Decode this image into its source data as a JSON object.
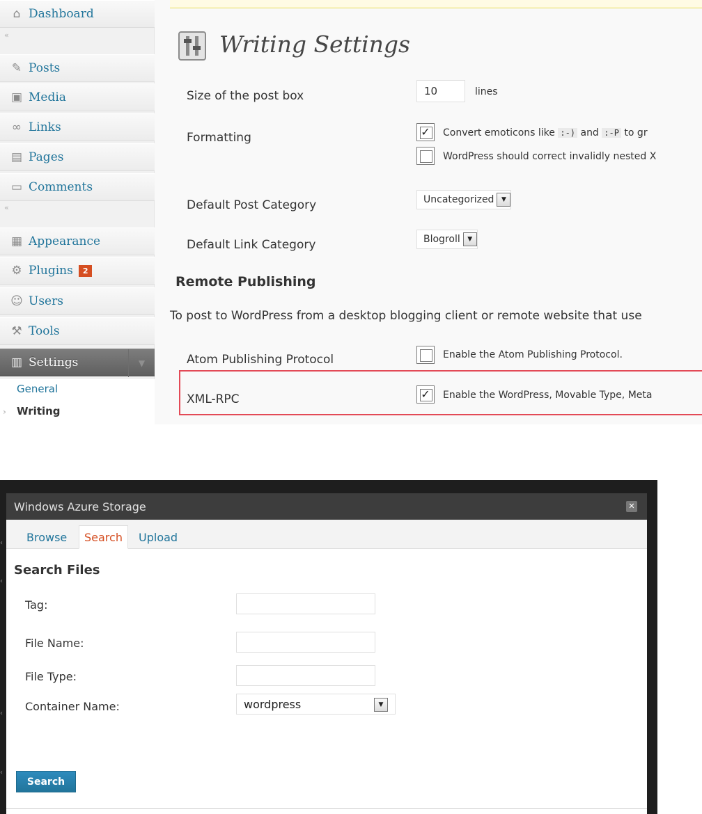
{
  "admin_menu": {
    "items": [
      {
        "label": "Dashboard",
        "icon": "dashboard-icon"
      },
      {
        "label": "Posts",
        "icon": "posts-pin-icon"
      },
      {
        "label": "Media",
        "icon": "media-icon"
      },
      {
        "label": "Links",
        "icon": "links-icon"
      },
      {
        "label": "Pages",
        "icon": "pages-icon"
      },
      {
        "label": "Comments",
        "icon": "comments-icon"
      },
      {
        "label": "Appearance",
        "icon": "appearance-icon"
      },
      {
        "label": "Plugins",
        "icon": "plugins-icon",
        "badge": "2"
      },
      {
        "label": "Users",
        "icon": "users-icon"
      },
      {
        "label": "Tools",
        "icon": "tools-icon"
      },
      {
        "label": "Settings",
        "icon": "settings-icon"
      }
    ],
    "separator_glyph": "«",
    "submenu": [
      {
        "label": "General"
      },
      {
        "label": "Writing"
      }
    ],
    "active_item": "Settings",
    "badge_color": "#d54e21",
    "link_color": "#21759b"
  },
  "writing_settings": {
    "title": "Writing Settings",
    "post_box_size": {
      "label": "Size of the post box",
      "value": "10",
      "unit": "lines"
    },
    "formatting": {
      "label": "Formatting",
      "option1_text_a": "Convert emoticons like",
      "option1_code_a": ":-)",
      "option1_text_b": "and",
      "option1_code_b": ":-P",
      "option1_text_c": "to gr",
      "option1_checked": true,
      "option2_text": "WordPress should correct invalidly nested X",
      "option2_checked": false
    },
    "default_post_category": {
      "label": "Default Post Category",
      "value": "Uncategorized"
    },
    "default_link_category": {
      "label": "Default Link Category",
      "value": "Blogroll"
    },
    "remote_publishing": {
      "heading": "Remote Publishing",
      "description": "To post to WordPress from a desktop blogging client or remote website that use",
      "atom": {
        "label": "Atom Publishing Protocol",
        "option_text": "Enable the Atom Publishing Protocol.",
        "checked": false
      },
      "xmlrpc": {
        "label": "XML-RPC",
        "option_text": "Enable the WordPress, Movable Type, Meta",
        "checked": true,
        "highlight_color": "#e34a57"
      }
    },
    "checkmark_glyph": "✓"
  },
  "azure_dialog": {
    "title": "Windows Azure Storage",
    "close_glyph": "✕",
    "tabs": [
      {
        "label": "Browse",
        "active": false
      },
      {
        "label": "Search",
        "active": true
      },
      {
        "label": "Upload",
        "active": false
      }
    ],
    "heading": "Search Files",
    "fields": {
      "tag": {
        "label": "Tag:",
        "value": ""
      },
      "file_name": {
        "label": "File Name:",
        "value": ""
      },
      "file_type": {
        "label": "File Type:",
        "value": ""
      },
      "container_name": {
        "label": "Container Name:",
        "value": "wordpress"
      }
    },
    "search_button": "Search",
    "button_color": "#21759b",
    "active_tab_color": "#d54e21"
  },
  "dropdown_glyph": "▼"
}
